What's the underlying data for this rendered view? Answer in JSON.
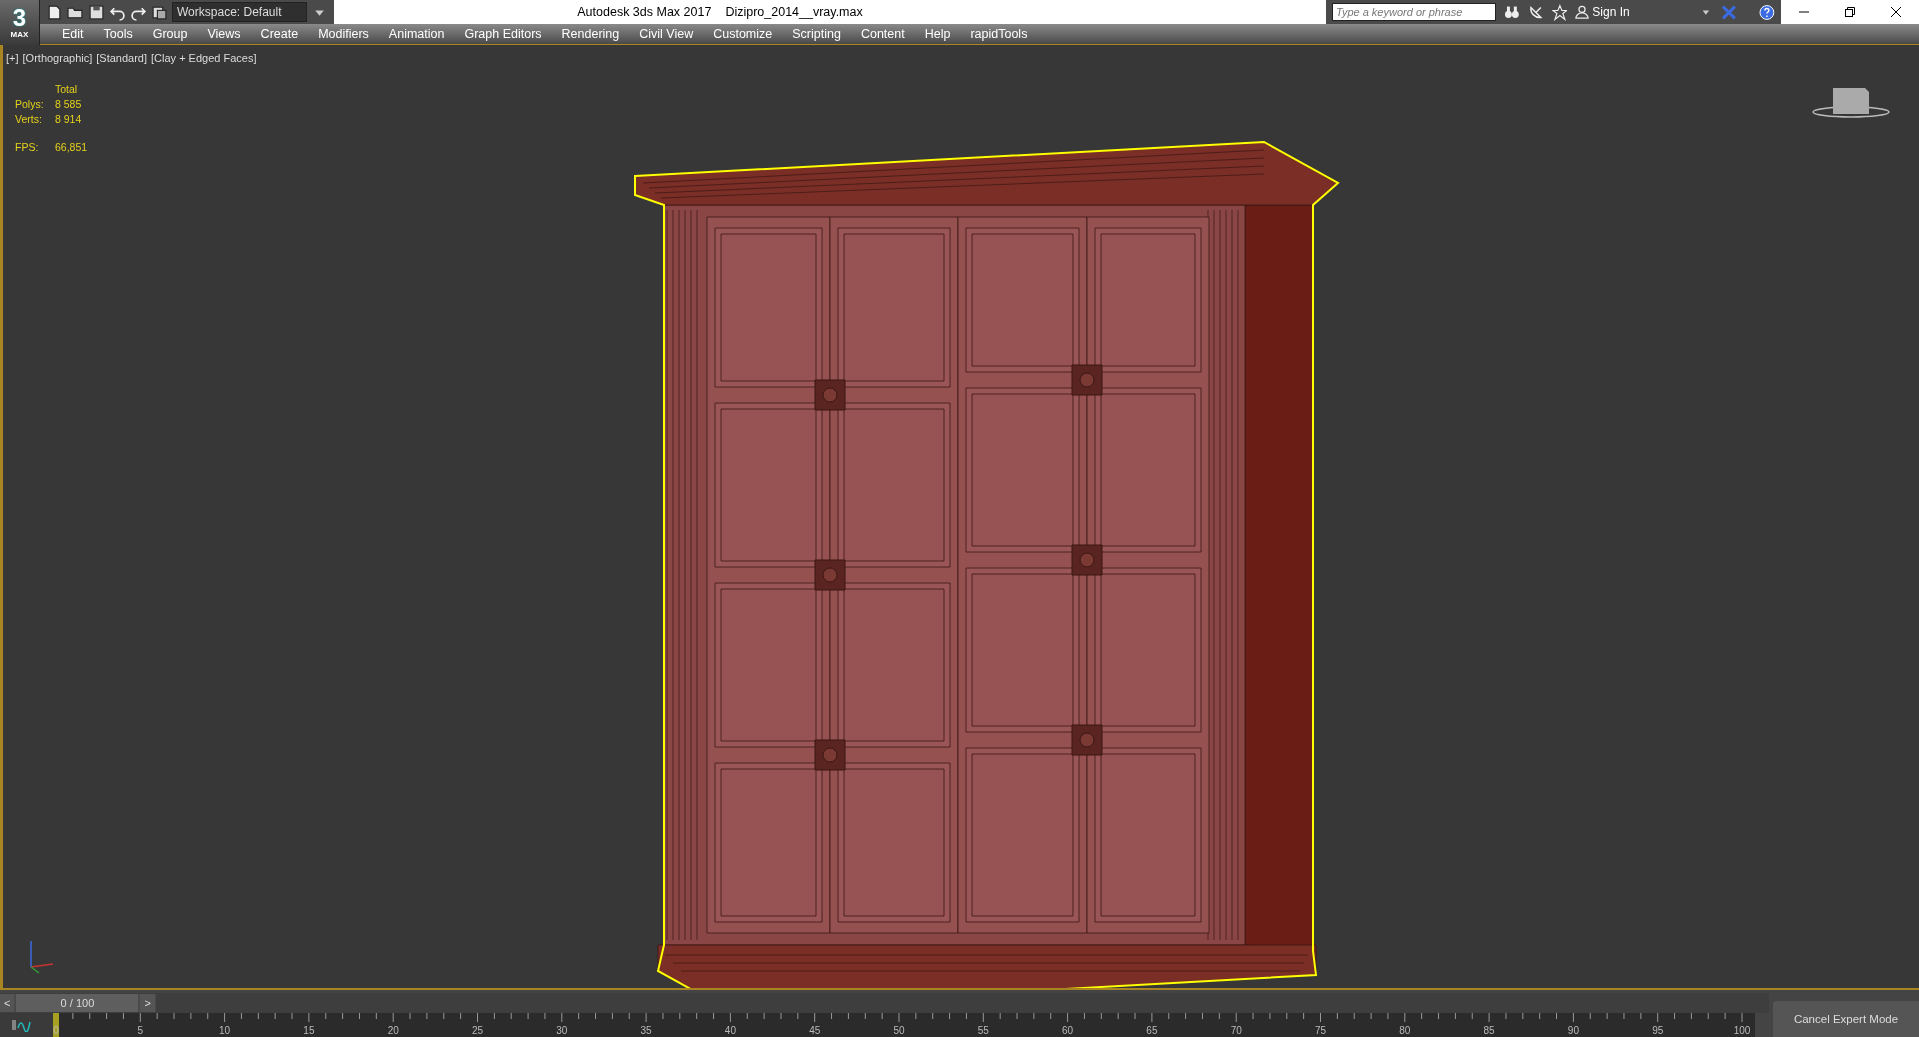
{
  "app": {
    "logo_number": "3",
    "logo_text": "MAX",
    "workspace": "Workspace: Default",
    "title": "Autodesk 3ds Max 2017",
    "file": "Dizipro_2014__vray.max"
  },
  "infocenter": {
    "search": {
      "placeholder": "Type a keyword or phrase"
    },
    "sign_in": "Sign In"
  },
  "menu": [
    "Edit",
    "Tools",
    "Group",
    "Views",
    "Create",
    "Modifiers",
    "Animation",
    "Graph Editors",
    "Rendering",
    "Civil View",
    "Customize",
    "Scripting",
    "Content",
    "Help",
    "rapidTools"
  ],
  "viewport": {
    "labels": [
      "[+]",
      "[Orthographic]",
      "[Standard]",
      "[Clay + Edged Faces]"
    ],
    "stats": {
      "header": "Total",
      "rows": [
        {
          "label": "Polys:",
          "value": "8 585"
        },
        {
          "label": "Verts:",
          "value": "8 914"
        }
      ],
      "fps_label": "FPS:",
      "fps_value": "66,851"
    },
    "selected": true
  },
  "time_slider": {
    "prev": "<",
    "frame": "0 / 100",
    "next": ">",
    "level": 0
  },
  "ruler": [
    "0",
    "5",
    "10",
    "15",
    "20",
    "25",
    "30",
    "35",
    "40",
    "45",
    "50",
    "55",
    "60",
    "65",
    "70",
    "75",
    "80",
    "85",
    "90",
    "95",
    "100"
  ],
  "expert_button": "Cancel Expert Mode"
}
